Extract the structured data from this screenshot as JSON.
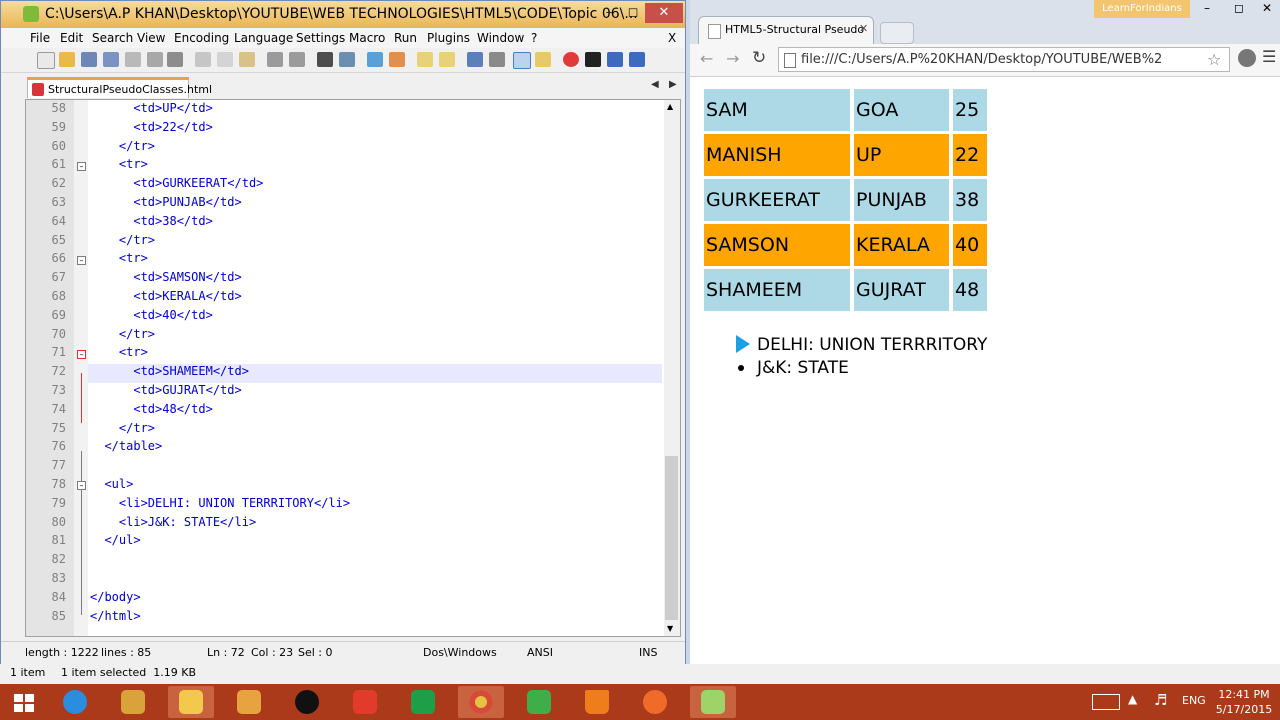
{
  "npp": {
    "title": "C:\\Users\\A.P KHAN\\Desktop\\YOUTUBE\\WEB TECHNOLOGIES\\HTML5\\CODE\\Topic 06\\...",
    "menu": [
      "File",
      "Edit",
      "Search",
      "View",
      "Encoding",
      "Language",
      "Settings",
      "Macro",
      "Run",
      "Plugins",
      "Window",
      "?"
    ],
    "close_x": "X",
    "tab": "StructuralPseudoClasses.html",
    "lines": [
      {
        "n": "58",
        "code": "      <td>UP</td>"
      },
      {
        "n": "59",
        "code": "      <td>22</td>"
      },
      {
        "n": "60",
        "code": "    </tr>"
      },
      {
        "n": "61",
        "code": "    <tr>"
      },
      {
        "n": "62",
        "code": "      <td>GURKEERAT</td>"
      },
      {
        "n": "63",
        "code": "      <td>PUNJAB</td>"
      },
      {
        "n": "64",
        "code": "      <td>38</td>"
      },
      {
        "n": "65",
        "code": "    </tr>"
      },
      {
        "n": "66",
        "code": "    <tr>"
      },
      {
        "n": "67",
        "code": "      <td>SAMSON</td>"
      },
      {
        "n": "68",
        "code": "      <td>KERALA</td>"
      },
      {
        "n": "69",
        "code": "      <td>40</td>"
      },
      {
        "n": "70",
        "code": "    </tr>"
      },
      {
        "n": "71",
        "code": "    <tr>"
      },
      {
        "n": "72",
        "code": "      <td>SHAMEEM</td>"
      },
      {
        "n": "73",
        "code": "      <td>GUJRAT</td>"
      },
      {
        "n": "74",
        "code": "      <td>48</td>"
      },
      {
        "n": "75",
        "code": "    </tr>"
      },
      {
        "n": "76",
        "code": "  </table>"
      },
      {
        "n": "77",
        "code": ""
      },
      {
        "n": "78",
        "code": "  <ul>"
      },
      {
        "n": "79",
        "code": "    <li>DELHI: UNION TERRRITORY</li>"
      },
      {
        "n": "80",
        "code": "    <li>J&K: STATE</li>"
      },
      {
        "n": "81",
        "code": "  </ul>"
      },
      {
        "n": "82",
        "code": ""
      },
      {
        "n": "83",
        "code": ""
      },
      {
        "n": "84",
        "code": "</body>"
      },
      {
        "n": "85",
        "code": "</html>"
      }
    ],
    "status": {
      "length": "length : 1222",
      "lines": "lines : 85",
      "ln": "Ln : 72",
      "col": "Col : 23",
      "sel": "Sel : 0",
      "eol": "Dos\\Windows",
      "enc": "ANSI",
      "mode": "INS"
    }
  },
  "chrome": {
    "tab_title": "HTML5-Structural Pseudo",
    "user": "LearnForIndians",
    "url": "file:///C:/Users/A.P%20KHAN/Desktop/YOUTUBE/WEB%2",
    "table": [
      {
        "name": "SAM",
        "state": "GOA",
        "age": "25",
        "style": "blue"
      },
      {
        "name": "MANISH",
        "state": "UP",
        "age": "22",
        "style": "orange"
      },
      {
        "name": "GURKEERAT",
        "state": "PUNJAB",
        "age": "38",
        "style": "blue"
      },
      {
        "name": "SAMSON",
        "state": "KERALA",
        "age": "40",
        "style": "orange"
      },
      {
        "name": "SHAMEEM",
        "state": "GUJRAT",
        "age": "48",
        "style": "blue"
      }
    ],
    "list": [
      "DELHI: UNION TERRRITORY",
      "J&K: STATE"
    ]
  },
  "explorer": {
    "items": "1 item",
    "selected": "1 item selected  1.19 KB"
  },
  "clock": {
    "time": "12:41 PM",
    "date": "5/17/2015"
  },
  "lang": "ENG",
  "colors": {
    "blue": "#add8e6",
    "orange": "#ffa500",
    "taskbar": "#ab3a1b"
  }
}
